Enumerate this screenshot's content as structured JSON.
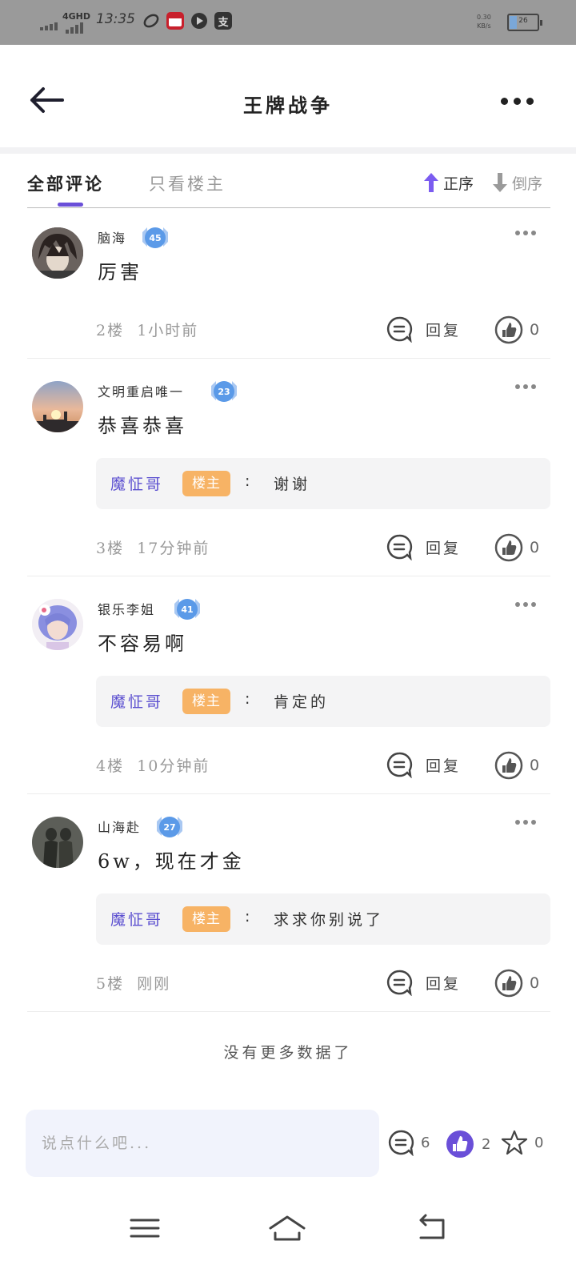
{
  "status_bar": {
    "network": "4GHD",
    "time": "13:35",
    "speed_value": "0.30",
    "speed_unit": "KB/s",
    "battery_level": "26",
    "battery_fraction": 0.26,
    "app_icons": [
      "link-app-icon",
      "calendar-app-icon",
      "video-app-icon",
      "study-app-icon"
    ],
    "study_icon_text": "支"
  },
  "header": {
    "title": "王牌战争"
  },
  "tabs": {
    "all": "全部评论",
    "owner_only": "只看楼主",
    "sort_asc": "正序",
    "sort_desc": "倒序"
  },
  "comments": [
    {
      "username": "脑海",
      "level": "45",
      "content": "厉害",
      "floor": "2楼",
      "time": "1小时前",
      "reply_label": "回复",
      "likes": "0",
      "reply": null
    },
    {
      "username": "文明重启唯一",
      "level": "23",
      "content": "恭喜恭喜",
      "floor": "3楼",
      "time": "17分钟前",
      "reply_label": "回复",
      "likes": "0",
      "reply": {
        "user": "魔怔哥",
        "tag": "楼主",
        "colon": ":",
        "text": "谢谢"
      }
    },
    {
      "username": "银乐李姐",
      "level": "41",
      "content": "不容易啊",
      "floor": "4楼",
      "time": "10分钟前",
      "reply_label": "回复",
      "likes": "0",
      "reply": {
        "user": "魔怔哥",
        "tag": "楼主",
        "colon": ":",
        "text": "肯定的"
      }
    },
    {
      "username": "山海赴",
      "level": "27",
      "content": "6w，现在才金",
      "floor": "5楼",
      "time": "刚刚",
      "reply_label": "回复",
      "likes": "0",
      "reply": {
        "user": "魔怔哥",
        "tag": "楼主",
        "colon": ":",
        "text": "求求你别说了"
      }
    }
  ],
  "no_more": "没有更多数据了",
  "bottom_bar": {
    "placeholder": "说点什么吧...",
    "comment_count": "6",
    "like_count": "2",
    "favorite_count": "0"
  },
  "colors": {
    "accent": "#6a4fd8",
    "owner_tag": "#f7b365",
    "reply_user": "#5b4fd0",
    "level_badge": "#5b9ae8"
  }
}
